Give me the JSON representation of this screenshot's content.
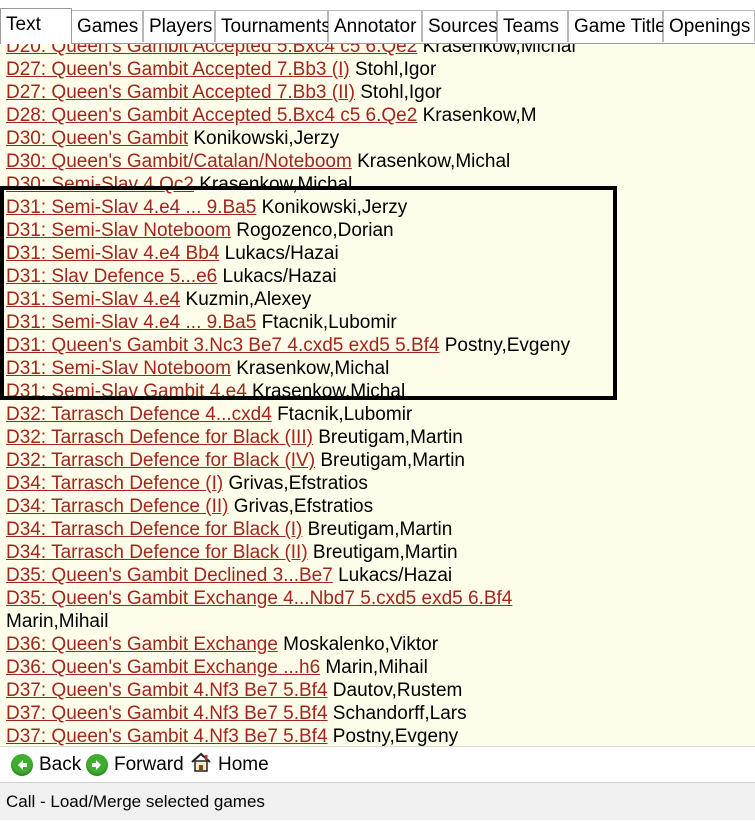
{
  "tabs": [
    {
      "label": "Text"
    },
    {
      "label": "Games"
    },
    {
      "label": "Players"
    },
    {
      "label": "Tournaments"
    },
    {
      "label": "Annotator"
    },
    {
      "label": "Sources"
    },
    {
      "label": "Teams"
    },
    {
      "label": "Game Title"
    },
    {
      "label": "Openings"
    }
  ],
  "entries": [
    {
      "link": "D20: Queen's Gambit Accepted 5.Bxc4 c5 6.Qe2",
      "author": " Krasenkow,Michal"
    },
    {
      "link": "D27: Queen's Gambit Accepted 7.Bb3 (I)",
      "author": " Stohl,Igor"
    },
    {
      "link": "D27: Queen's Gambit Accepted 7.Bb3 (II)",
      "author": " Stohl,Igor"
    },
    {
      "link": "D28: Queen's Gambit Accepted 5.Bxc4 c5 6.Qe2",
      "author": " Krasenkow,M"
    },
    {
      "link": "D30: Queen's Gambit",
      "author": " Konikowski,Jerzy"
    },
    {
      "link": "D30: Queen's Gambit/Catalan/Noteboom",
      "author": " Krasenkow,Michal"
    },
    {
      "link": "D30: Semi-Slav 4.Qc2",
      "author": " Krasenkow,Michal"
    },
    {
      "link": "D31: Semi-Slav 4.e4 ... 9.Ba5",
      "author": " Konikowski,Jerzy"
    },
    {
      "link": "D31: Semi-Slav Noteboom",
      "author": " Rogozenco,Dorian"
    },
    {
      "link": "D31: Semi-Slav 4.e4 Bb4",
      "author": " Lukacs/Hazai"
    },
    {
      "link": "D31: Slav Defence 5...e6",
      "author": " Lukacs/Hazai"
    },
    {
      "link": "D31: Semi-Slav 4.e4",
      "author": " Kuzmin,Alexey"
    },
    {
      "link": "D31: Semi-Slav 4.e4 ... 9.Ba5",
      "author": " Ftacnik,Lubomir"
    },
    {
      "link": "D31: Queen's Gambit 3.Nc3 Be7 4.cxd5 exd5 5.Bf4",
      "author": " Postny,Evgeny"
    },
    {
      "link": "D31: Semi-Slav Noteboom",
      "author": " Krasenkow,Michal"
    },
    {
      "link": "D31: Semi-Slav Gambit 4.e4",
      "author": " Krasenkow,Michal"
    },
    {
      "link": "D32: Tarrasch Defence 4...cxd4",
      "author": " Ftacnik,Lubomir"
    },
    {
      "link": "D32: Tarrasch Defence for Black (III)",
      "author": " Breutigam,Martin"
    },
    {
      "link": "D32: Tarrasch Defence for Black (IV)",
      "author": " Breutigam,Martin"
    },
    {
      "link": "D34: Tarrasch Defence (I)",
      "author": " Grivas,Efstratios"
    },
    {
      "link": "D34: Tarrasch Defence (II)",
      "author": " Grivas,Efstratios"
    },
    {
      "link": "D34: Tarrasch Defence for Black (I)",
      "author": " Breutigam,Martin"
    },
    {
      "link": "D34: Tarrasch Defence for Black (II)",
      "author": " Breutigam,Martin"
    },
    {
      "link": "D35: Queen's Gambit Declined 3...Be7",
      "author": " Lukacs/Hazai"
    },
    {
      "link": "D35: Queen's Gambit Exchange 4...Nbd7 5.cxd5 exd5 6.Bf4",
      "author": ""
    },
    {
      "link": "",
      "author": "Marin,Mihail"
    },
    {
      "link": "D36: Queen's Gambit Exchange",
      "author": " Moskalenko,Viktor"
    },
    {
      "link": "D36: Queen's Gambit Exchange ...h6",
      "author": " Marin,Mihail"
    },
    {
      "link": "D37: Queen's Gambit 4.Nf3 Be7 5.Bf4",
      "author": " Dautov,Rustem"
    },
    {
      "link": "D37: Queen's Gambit 4.Nf3 Be7 5.Bf4",
      "author": " Schandorff,Lars"
    },
    {
      "link": "D37: Queen's Gambit 4.Nf3 Be7 5.Bf4",
      "author": " Postny,Evgeny"
    }
  ],
  "nav": {
    "back_label": "Back",
    "forward_label": "Forward",
    "home_label": "Home"
  },
  "status": {
    "text": "Call - Load/Merge selected games"
  },
  "colors": {
    "link": "#a0261e",
    "content_bg": "#fdfdea",
    "nav_icon": "#3fae2f"
  }
}
